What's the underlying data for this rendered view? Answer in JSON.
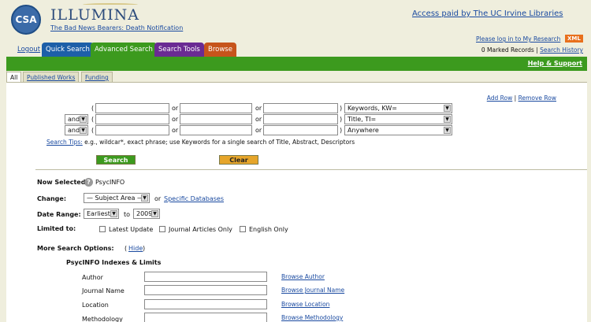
{
  "header": {
    "logo_text": "CSA",
    "brand": "ILLUMINA",
    "subtitle": "The Bad News Bearers: Death Notification",
    "access": "Access paid by The UC Irvine Libraries",
    "login": "Please log in to My Research",
    "xml": "XML",
    "marked_records": "0 Marked Records",
    "separator": "|",
    "search_history": "Search History"
  },
  "tabs": {
    "logout": "Logout",
    "quick": "Quick Search",
    "advanced": "Advanced Search",
    "tools": "Search Tools",
    "browse": "Browse"
  },
  "greenbar": {
    "help": "Help & Support"
  },
  "subtabs": {
    "all": "All",
    "published": "Published Works",
    "funding": "Funding"
  },
  "row_links": {
    "add": "Add Row",
    "sep": "|",
    "remove": "Remove Row"
  },
  "search_rows": {
    "or": "or",
    "open_paren": "(",
    "close_paren": ")",
    "operator_row2": "and",
    "operator_row3": "and",
    "field_row1": "Keywords, KW=",
    "field_row2": "Title, TI=",
    "field_row3": "Anywhere"
  },
  "search_tips": {
    "link": "Search Tips:",
    "text": "e.g., wildcar*, exact phrase; use Keywords for a single search of Title, Abstract, Descriptors"
  },
  "buttons": {
    "search": "Search",
    "clear": "Clear"
  },
  "options": {
    "now_selected_label": "Now Selected:",
    "now_selected_value": "PsycINFO",
    "change_label": "Change:",
    "subject_area": "— Subject Area —",
    "or": "or",
    "specific_databases": "Specific Databases",
    "date_range_label": "Date Range:",
    "date_from": "Earliest",
    "to": "to",
    "date_to": "2009",
    "limited_label": "Limited to:",
    "latest_update": "Latest Update",
    "journal_articles": "Journal Articles Only",
    "english_only": "English Only",
    "more_options_label": "More Search Options:",
    "hide_open": "(",
    "hide": "Hide",
    "hide_close": ")",
    "indexes_title": "PsycINFO Indexes & Limits"
  },
  "index_fields": [
    {
      "label": "Author",
      "browse": "Browse Author"
    },
    {
      "label": "Journal Name",
      "browse": "Browse Journal Name"
    },
    {
      "label": "Location",
      "browse": "Browse Location"
    },
    {
      "label": "Methodology",
      "browse": "Browse Methodology"
    }
  ],
  "colors": {
    "green": "#3c9a1e",
    "blue_tab": "#1d5fa8",
    "purple_tab": "#6a2b93",
    "orange_tab": "#c6541b",
    "link": "#1a4aa0",
    "background": "#efeedd"
  }
}
